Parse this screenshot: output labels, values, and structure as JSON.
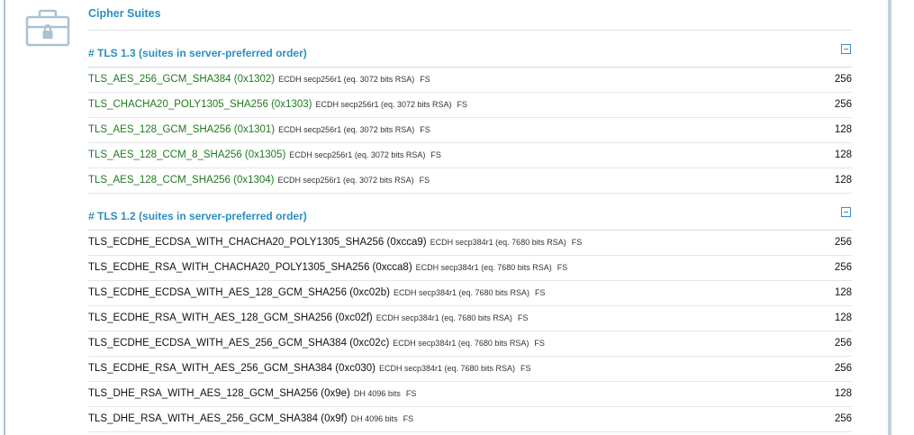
{
  "section": {
    "title": "Cipher Suites",
    "icon": "lock-box-icon"
  },
  "colors": {
    "accent": "#2a8fbf",
    "strong_suite": "#1f7a1f",
    "normal_suite": "#111111"
  },
  "groups": [
    {
      "title": "# TLS 1.3 (suites in server-preferred order)",
      "collapse_icon": "minus-square-icon",
      "style": "strong",
      "rows": [
        {
          "name": "TLS_AES_256_GCM_SHA384",
          "code": "(0x1302)",
          "kx": "ECDH secp256r1 (eq. 3072 bits RSA)",
          "fs": "FS",
          "bits": "256"
        },
        {
          "name": "TLS_CHACHA20_POLY1305_SHA256",
          "code": "(0x1303)",
          "kx": "ECDH secp256r1 (eq. 3072 bits RSA)",
          "fs": "FS",
          "bits": "256"
        },
        {
          "name": "TLS_AES_128_GCM_SHA256",
          "code": "(0x1301)",
          "kx": "ECDH secp256r1 (eq. 3072 bits RSA)",
          "fs": "FS",
          "bits": "128"
        },
        {
          "name": "TLS_AES_128_CCM_8_SHA256",
          "code": "(0x1305)",
          "kx": "ECDH secp256r1 (eq. 3072 bits RSA)",
          "fs": "FS",
          "bits": "128"
        },
        {
          "name": "TLS_AES_128_CCM_SHA256",
          "code": "(0x1304)",
          "kx": "ECDH secp256r1 (eq. 3072 bits RSA)",
          "fs": "FS",
          "bits": "128"
        }
      ]
    },
    {
      "title": "# TLS 1.2 (suites in server-preferred order)",
      "collapse_icon": "minus-square-icon",
      "style": "normal",
      "rows": [
        {
          "name": "TLS_ECDHE_ECDSA_WITH_CHACHA20_POLY1305_SHA256",
          "code": "(0xcca9)",
          "kx": "ECDH secp384r1 (eq. 7680 bits RSA)",
          "fs": "FS",
          "bits": "256"
        },
        {
          "name": "TLS_ECDHE_RSA_WITH_CHACHA20_POLY1305_SHA256",
          "code": "(0xcca8)",
          "kx": "ECDH secp384r1 (eq. 7680 bits RSA)",
          "fs": "FS",
          "bits": "256"
        },
        {
          "name": "TLS_ECDHE_ECDSA_WITH_AES_128_GCM_SHA256",
          "code": "(0xc02b)",
          "kx": "ECDH secp384r1 (eq. 7680 bits RSA)",
          "fs": "FS",
          "bits": "128"
        },
        {
          "name": "TLS_ECDHE_RSA_WITH_AES_128_GCM_SHA256",
          "code": "(0xc02f)",
          "kx": "ECDH secp384r1 (eq. 7680 bits RSA)",
          "fs": "FS",
          "bits": "128"
        },
        {
          "name": "TLS_ECDHE_ECDSA_WITH_AES_256_GCM_SHA384",
          "code": "(0xc02c)",
          "kx": "ECDH secp384r1 (eq. 7680 bits RSA)",
          "fs": "FS",
          "bits": "256"
        },
        {
          "name": "TLS_ECDHE_RSA_WITH_AES_256_GCM_SHA384",
          "code": "(0xc030)",
          "kx": "ECDH secp384r1 (eq. 7680 bits RSA)",
          "fs": "FS",
          "bits": "256"
        },
        {
          "name": "TLS_DHE_RSA_WITH_AES_128_GCM_SHA256",
          "code": "(0x9e)",
          "kx": "DH 4096 bits",
          "fs": "FS",
          "bits": "128"
        },
        {
          "name": "TLS_DHE_RSA_WITH_AES_256_GCM_SHA384",
          "code": "(0x9f)",
          "kx": "DH 4096 bits",
          "fs": "FS",
          "bits": "256"
        }
      ]
    }
  ]
}
